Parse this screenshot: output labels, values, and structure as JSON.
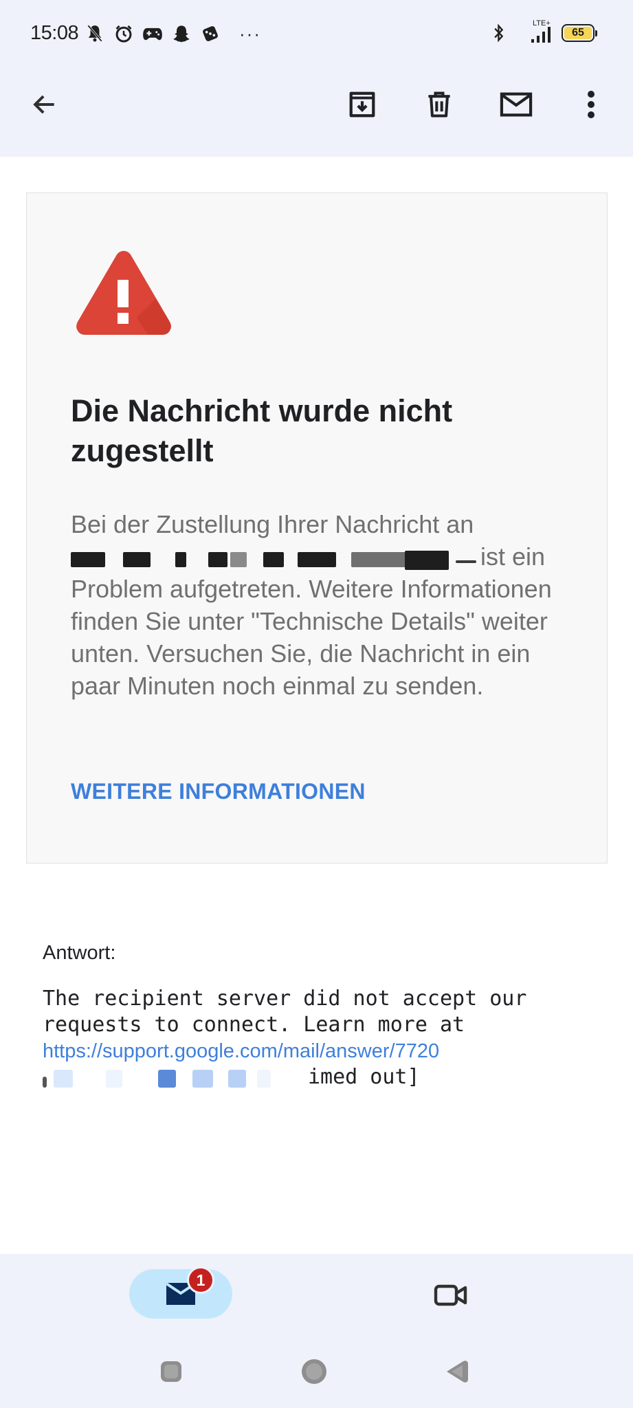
{
  "status_bar": {
    "time": "15:08",
    "network": "LTE+",
    "battery": "65",
    "more": "···"
  },
  "toolbar": {
    "icons": [
      "back-arrow-icon",
      "archive-icon",
      "delete-icon",
      "mark-unread-icon",
      "more-vert-icon"
    ]
  },
  "card": {
    "icon": "warning-icon",
    "title": "Die Nachricht wurde nicht zugestellt",
    "body_line1": "Bei der Zustellung Ihrer Nachricht an",
    "body_after_redaction": "ist ein",
    "body_rest": "Problem aufgetreten. Weitere Informationen finden Sie unter \"Technische Details\" weiter unten. Versuchen Sie, die Nachricht in ein paar Minuten noch einmal zu senden.",
    "link": "WEITERE INFORMATIONEN"
  },
  "response": {
    "label": "Antwort:",
    "text": "The recipient server did not accept our\nrequests to connect. Learn more at",
    "url": "https://support.google.com/mail/answer/7720",
    "tail": "imed out]"
  },
  "bottom_nav": {
    "mail_badge": "1",
    "items": [
      "mail-icon",
      "video-camera-icon"
    ]
  },
  "colors": {
    "accent_blue": "#3e7fdb",
    "warning_red": "#db4437",
    "badge_red": "#c5221f",
    "header_bg": "#eff2fa",
    "nav_pill": "#c2e7fd"
  }
}
